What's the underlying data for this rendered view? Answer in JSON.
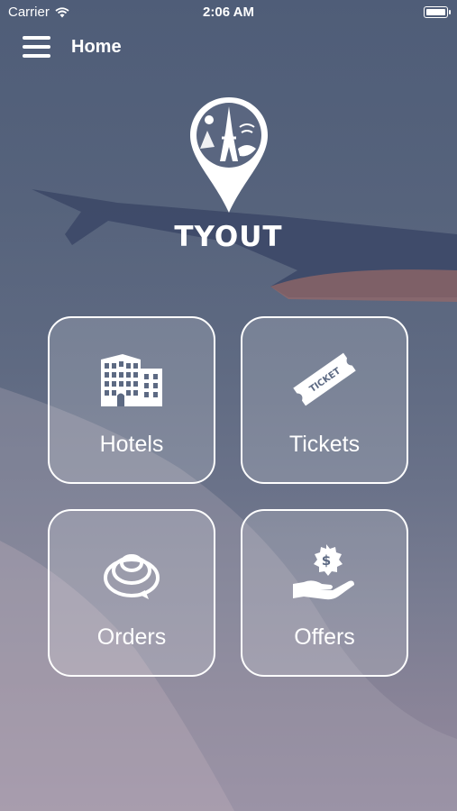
{
  "status_bar": {
    "carrier": "Carrier",
    "time": "2:06 AM"
  },
  "nav": {
    "title": "Home"
  },
  "brand": {
    "name": "TYOUT"
  },
  "tiles": [
    {
      "label": "Hotels",
      "icon": "hotel-building-icon"
    },
    {
      "label": "Tickets",
      "icon": "ticket-icon"
    },
    {
      "label": "Orders",
      "icon": "orders-spiral-icon"
    },
    {
      "label": "Offers",
      "icon": "offers-hand-dollar-icon"
    }
  ],
  "ticket_icon_text": "TICKET",
  "offers_icon_symbol": "$"
}
